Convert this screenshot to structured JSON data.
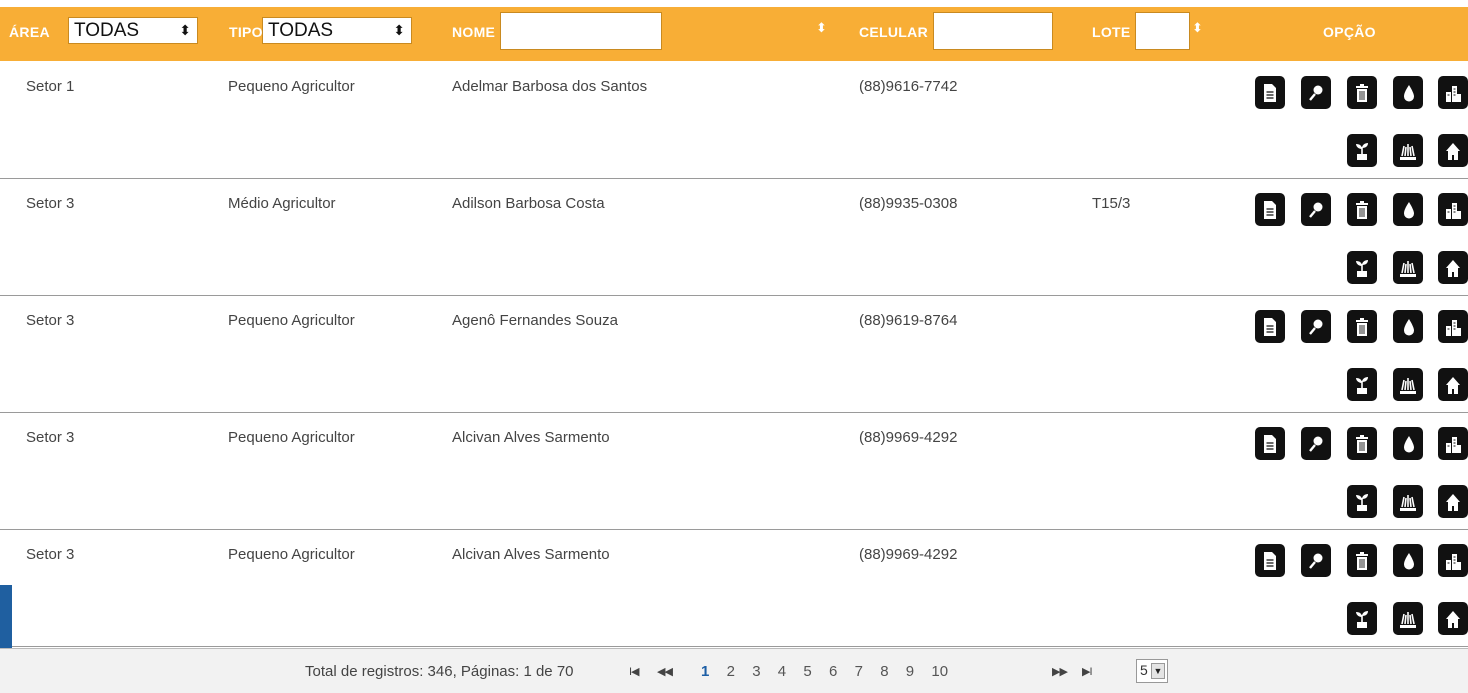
{
  "header": {
    "area_label": "ÁREA",
    "area_value": "TODAS",
    "tipo_label": "TIPO",
    "tipo_value": "TODAS",
    "nome_label": "NOME",
    "celular_label": "CELULAR",
    "lote_label": "LOTE",
    "opcao_label": "OPÇÃO"
  },
  "rows": [
    {
      "area": "Setor 1",
      "tipo": "Pequeno Agricultor",
      "nome": "Adelmar Barbosa dos Santos",
      "celular": "(88)9616-7742",
      "lote": ""
    },
    {
      "area": "Setor 3",
      "tipo": "Médio Agricultor",
      "nome": "Adilson Barbosa Costa",
      "celular": "(88)9935-0308",
      "lote": "T15/3"
    },
    {
      "area": "Setor 3",
      "tipo": "Pequeno Agricultor",
      "nome": "Agenô Fernandes Souza",
      "celular": "(88)9619-8764",
      "lote": ""
    },
    {
      "area": "Setor 3",
      "tipo": "Pequeno Agricultor",
      "nome": "Alcivan Alves Sarmento",
      "celular": "(88)9969-4292",
      "lote": ""
    },
    {
      "area": "Setor 3",
      "tipo": "Pequeno Agricultor",
      "nome": "Alcivan Alves Sarmento",
      "celular": "(88)9969-4292",
      "lote": ""
    }
  ],
  "row_action_icons": [
    "document-icon",
    "search-icon",
    "trash-icon",
    "drop-icon",
    "buildings-icon",
    "plant-icon",
    "crop-icon",
    "home-icon"
  ],
  "footer": {
    "summary": "Total de registros: 346, Páginas: 1 de 70",
    "nav_first": "I◀",
    "nav_prev": "◀◀",
    "pages": [
      "1",
      "2",
      "3",
      "4",
      "5",
      "6",
      "7",
      "8",
      "9",
      "10"
    ],
    "current_page": "1",
    "nav_next": "▶▶",
    "nav_last": "▶I",
    "page_size": "5"
  },
  "colors": {
    "header": "#f8ae36",
    "active_page": "#1d5fa6"
  }
}
